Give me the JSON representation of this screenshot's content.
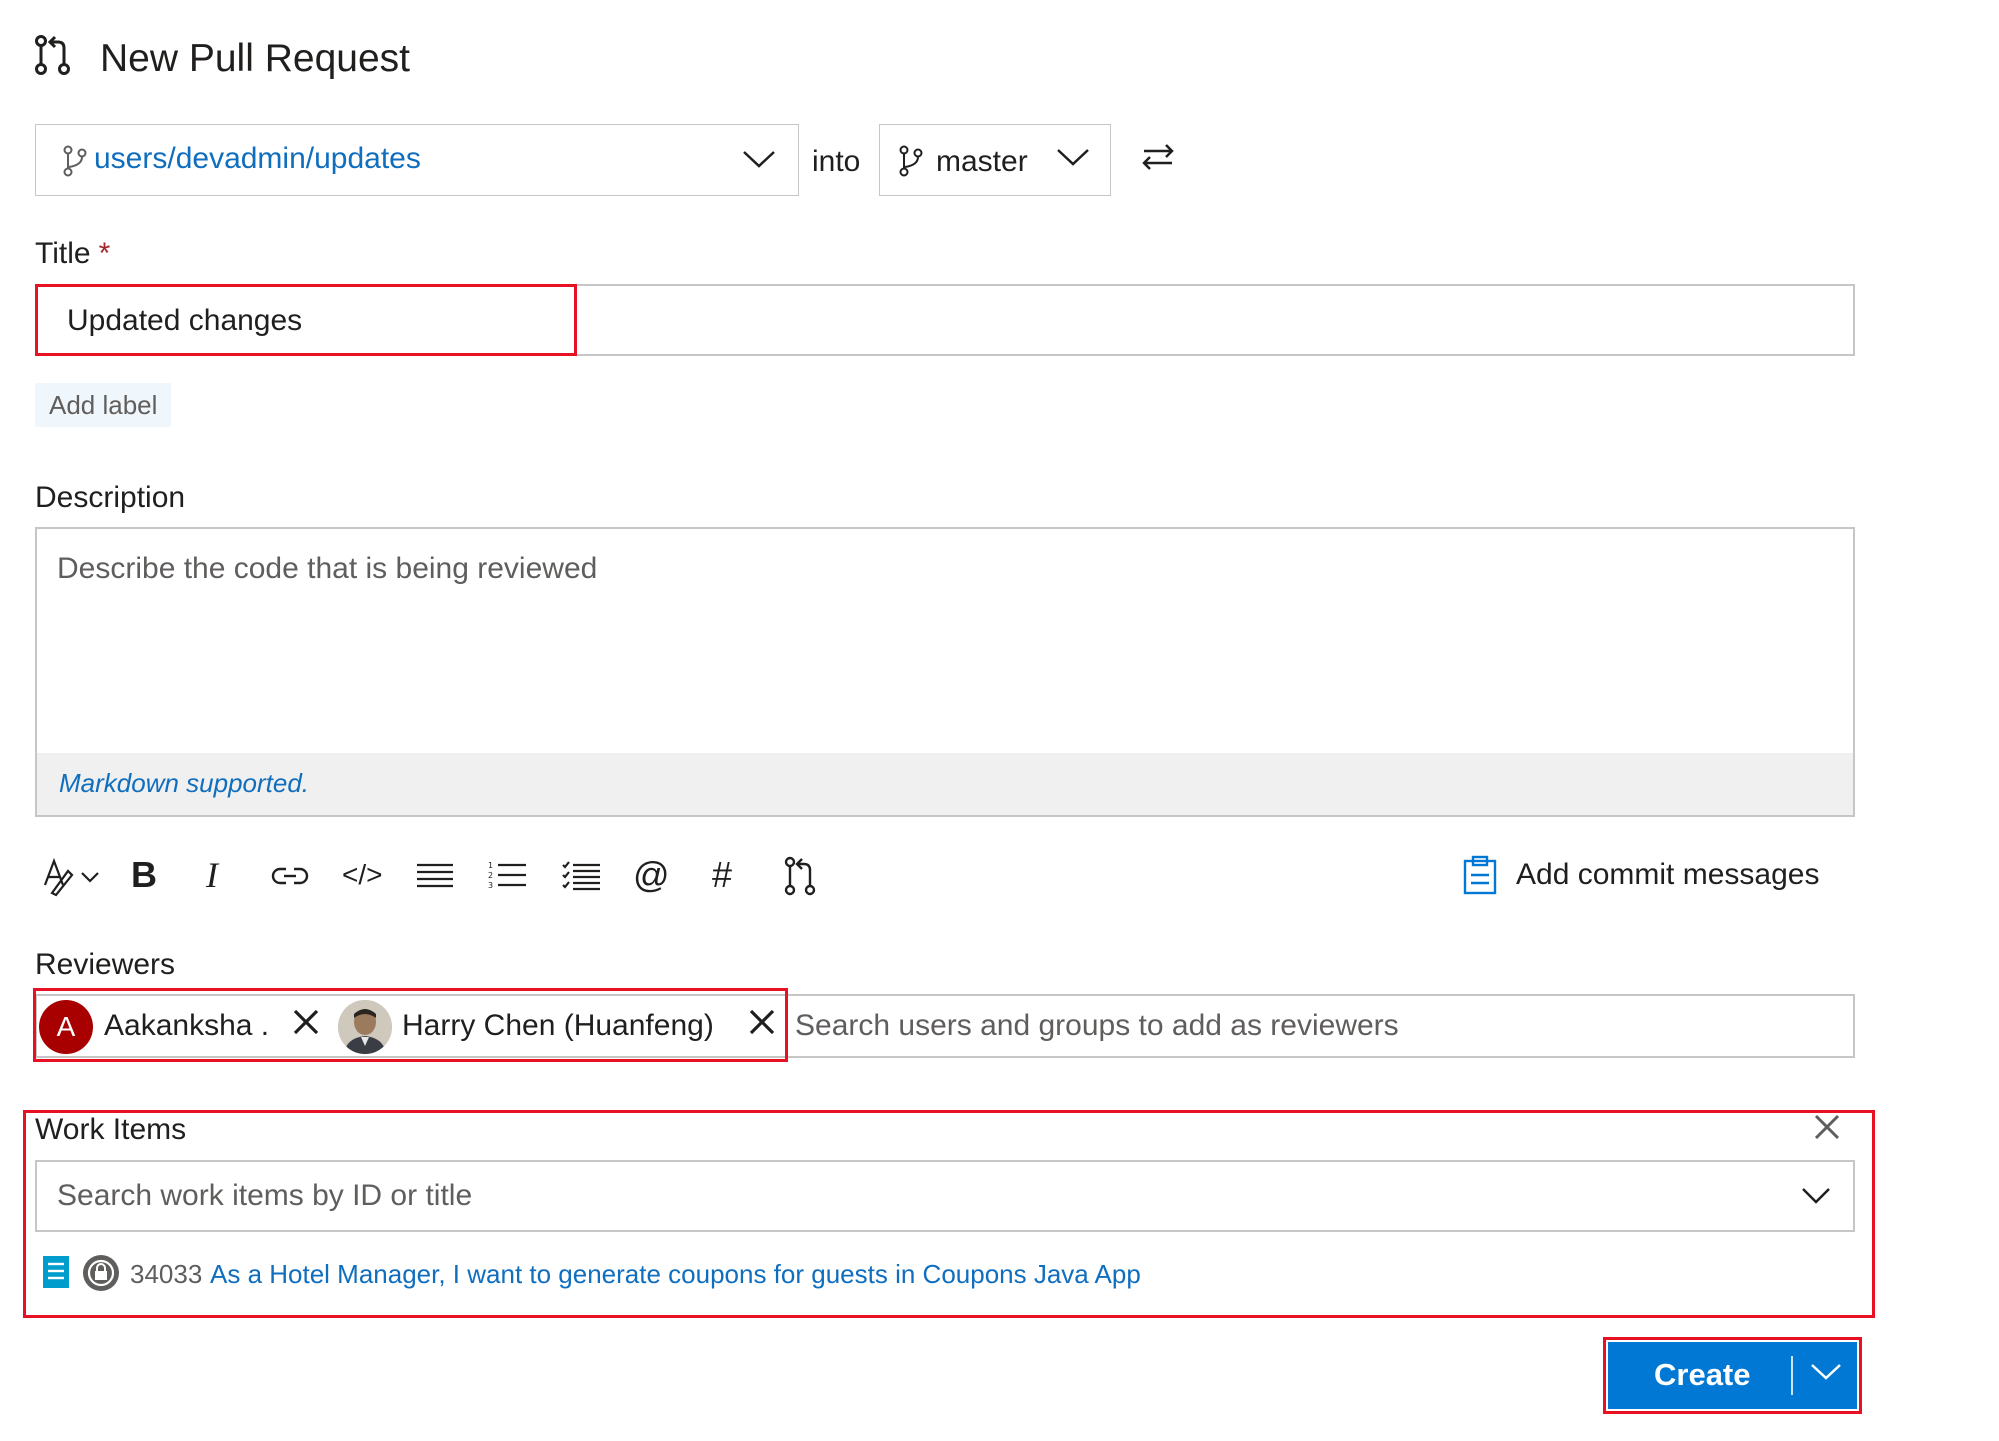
{
  "page": {
    "title": "New Pull Request"
  },
  "branches": {
    "source": "users/devadmin/updates",
    "into_label": "into",
    "target": "master"
  },
  "title_field": {
    "label": "Title",
    "required_mark": "*",
    "value": "Updated changes"
  },
  "add_label": "Add label",
  "description": {
    "label": "Description",
    "placeholder": "Describe the code that is being reviewed",
    "markdown_note": "Markdown supported."
  },
  "toolbar": {
    "bold": "B",
    "italic": "I",
    "code": "</>",
    "mention": "@",
    "hashtag": "#",
    "add_commit_messages": "Add commit messages"
  },
  "reviewers": {
    "label": "Reviewers",
    "items": [
      {
        "initial": "A",
        "name": "Aakanksha ."
      },
      {
        "name": "Harry Chen (Huanfeng)"
      }
    ],
    "placeholder": "Search users and groups to add as reviewers"
  },
  "work_items": {
    "label": "Work Items",
    "search_placeholder": "Search work items by ID or title",
    "items": [
      {
        "id": "34033",
        "title": "As a Hotel Manager, I want to generate coupons for guests in Coupons Java App"
      }
    ]
  },
  "create_button": {
    "label": "Create"
  },
  "colors": {
    "accent": "#0078d4",
    "link": "#106ebe",
    "highlight": "#e81123",
    "avatar_a": "#a80000"
  }
}
